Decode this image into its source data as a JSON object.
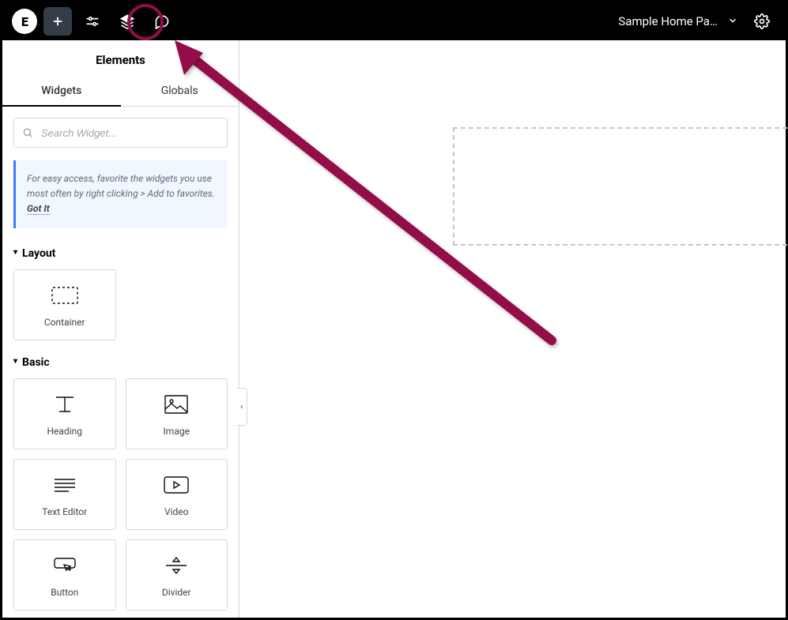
{
  "topbar": {
    "logo_text": "E",
    "page_title": "Sample Home Pa…"
  },
  "panel": {
    "title": "Elements",
    "tabs": {
      "widgets": "Widgets",
      "globals": "Globals"
    },
    "search_placeholder": "Search Widget...",
    "tip_text": "For easy access, favorite the widgets you use most often by right clicking > Add to favorites.",
    "tip_link": "Got It"
  },
  "sections": {
    "layout": {
      "title": "Layout",
      "items": [
        {
          "id": "container",
          "label": "Container"
        }
      ]
    },
    "basic": {
      "title": "Basic",
      "items": [
        {
          "id": "heading",
          "label": "Heading"
        },
        {
          "id": "image",
          "label": "Image"
        },
        {
          "id": "text-editor",
          "label": "Text Editor"
        },
        {
          "id": "video",
          "label": "Video"
        },
        {
          "id": "button",
          "label": "Button"
        },
        {
          "id": "divider",
          "label": "Divider"
        }
      ]
    }
  },
  "colors": {
    "annotation": "#930E49"
  }
}
